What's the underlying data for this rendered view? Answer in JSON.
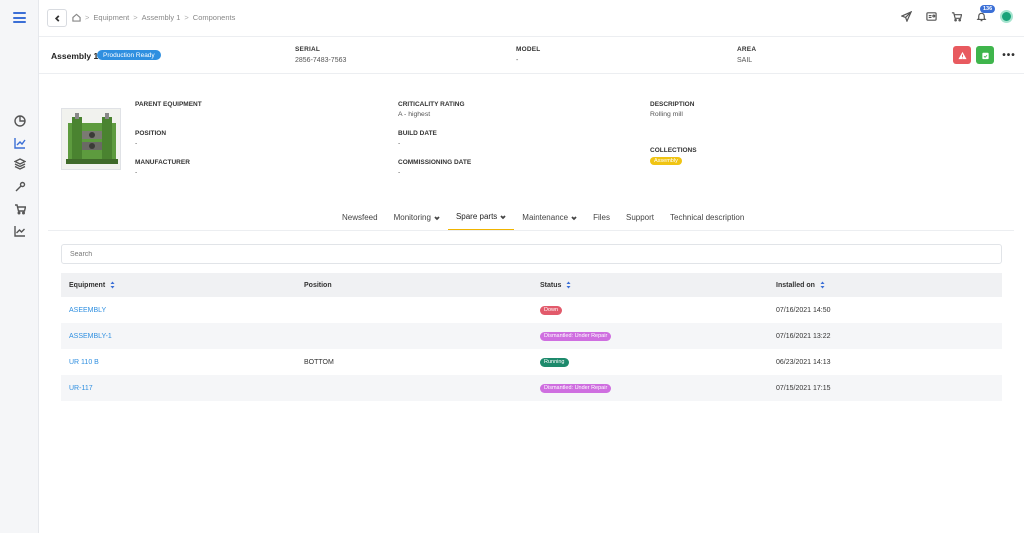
{
  "breadcrumb": [
    "Equipment",
    "Assembly 1",
    "Components"
  ],
  "notifications_count": "136",
  "header": {
    "title": "Assembly 1",
    "status": "Production Ready",
    "serial_label": "SERIAL",
    "serial_value": "2856-7483-7563",
    "model_label": "MODEL",
    "model_value": "-",
    "area_label": "AREA",
    "area_value": "SAIL"
  },
  "details": {
    "parent_label": "PARENT EQUIPMENT",
    "parent_value": "",
    "position_label": "POSITION",
    "position_value": "-",
    "manufacturer_label": "MANUFACTURER",
    "manufacturer_value": "-",
    "criticality_label": "CRITICALITY RATING",
    "criticality_value": "A - highest",
    "build_label": "BUILD DATE",
    "build_value": "-",
    "commissioning_label": "COMMISSIONING DATE",
    "commissioning_value": "-",
    "description_label": "DESCRIPTION",
    "description_value": "Rolling mill",
    "collections_label": "COLLECTIONS",
    "collections_tag": "Assembly"
  },
  "tabs": [
    {
      "label": "Newsfeed",
      "has_menu": false
    },
    {
      "label": "Monitoring",
      "has_menu": true
    },
    {
      "label": "Spare parts",
      "has_menu": true,
      "active": true
    },
    {
      "label": "Maintenance",
      "has_menu": true
    },
    {
      "label": "Files",
      "has_menu": false
    },
    {
      "label": "Support",
      "has_menu": false
    },
    {
      "label": "Technical description",
      "has_menu": false
    }
  ],
  "search": {
    "placeholder": "Search"
  },
  "table": {
    "headers": {
      "equipment": "Equipment",
      "position": "Position",
      "status": "Status",
      "installed": "Installed on"
    },
    "rows": [
      {
        "equipment": "ASEEMBLY",
        "position": "",
        "status": "Down",
        "status_type": "down",
        "installed": "07/16/2021 14:50"
      },
      {
        "equipment": "ASSEMBLY-1",
        "position": "",
        "status": "Dismantled: Under Repair",
        "status_type": "dism",
        "installed": "07/16/2021 13:22"
      },
      {
        "equipment": "UR 110 B",
        "position": "BOTTOM",
        "status": "Running",
        "status_type": "run",
        "installed": "06/23/2021 14:13"
      },
      {
        "equipment": "UR-117",
        "position": "",
        "status": "Dismantled: Under Repair",
        "status_type": "dism",
        "installed": "07/15/2021 17:15"
      }
    ]
  },
  "colors": {
    "accent": "#2f8fe0",
    "active_tab": "#f0b400",
    "alert": "#e85a5f",
    "success": "#3fb54c"
  }
}
